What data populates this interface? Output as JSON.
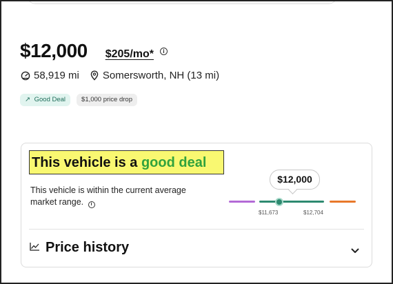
{
  "listing": {
    "price": "$12,000",
    "monthly_payment": "$205/mo*",
    "mileage": "58,919 mi",
    "location": "Somersworth, NH (13 mi)"
  },
  "badges": [
    {
      "label": "Good Deal",
      "icon": "trend-up-arrow-icon"
    },
    {
      "label": "$1,000 price drop"
    }
  ],
  "deal": {
    "title_prefix": "This vehicle is a ",
    "title_highlight": "good deal",
    "description": "This vehicle is within the current average market range.",
    "bubble_price": "$12,000",
    "range_low": "$11,673",
    "range_high": "$12,704",
    "colors": {
      "below_market": "#b36ad6",
      "market": "#2d8a70",
      "above_market": "#e8782a",
      "highlight": "#f9f871",
      "good_text": "#31a23d"
    }
  },
  "history": {
    "label": "Price history",
    "icon": "line-chart-icon",
    "toggle_icon": "chevron-down-icon"
  }
}
